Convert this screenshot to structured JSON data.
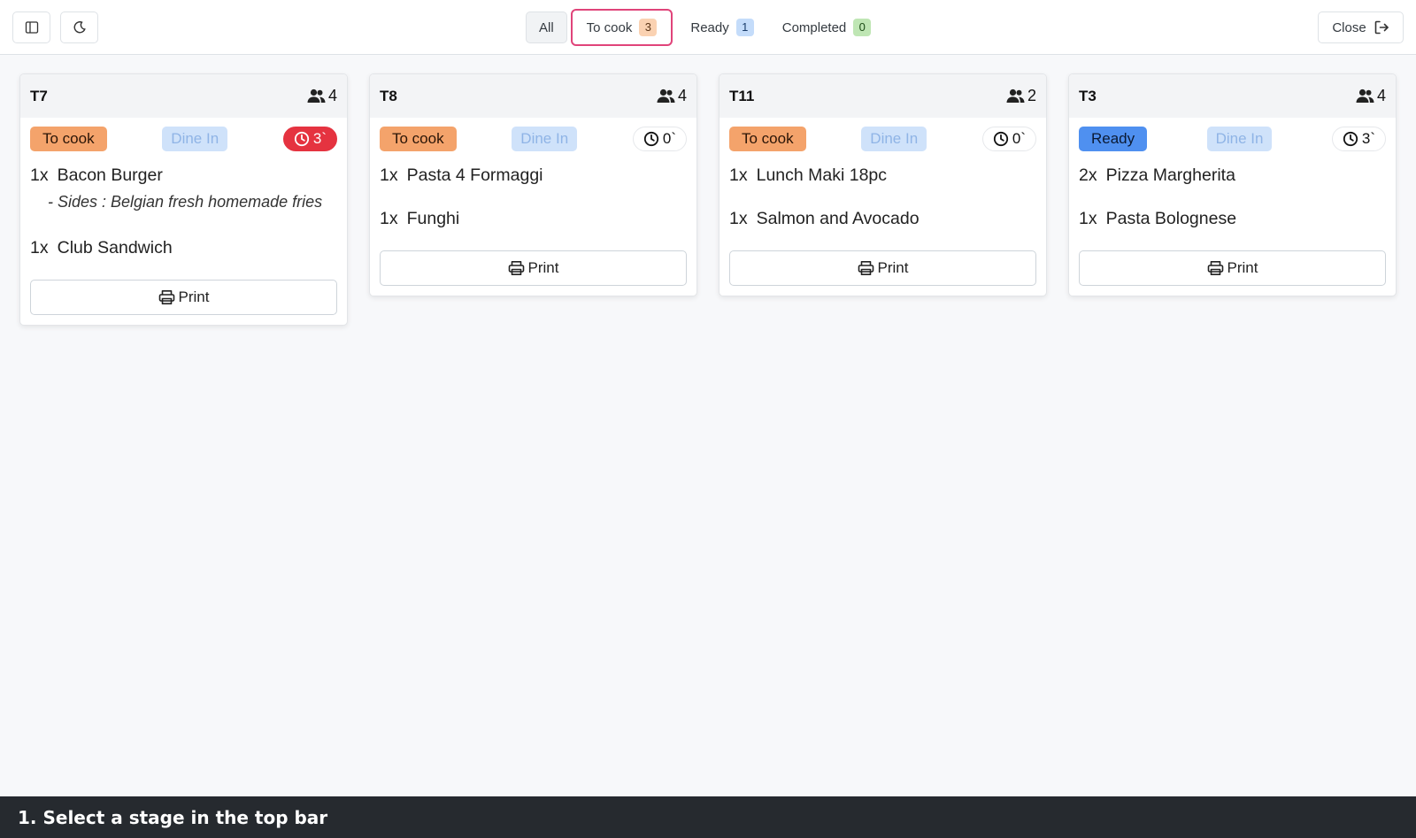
{
  "toolbar": {
    "sidebar_icon": "sidebar-toggle-icon",
    "theme_icon": "moon-icon"
  },
  "stages": [
    {
      "label": "All"
    },
    {
      "label": "To cook",
      "count": "3"
    },
    {
      "label": "Ready",
      "count": "1"
    },
    {
      "label": "Completed",
      "count": "0"
    }
  ],
  "close": {
    "label": "Close",
    "icon": "sign-out-icon"
  },
  "orders": [
    {
      "table": "T7",
      "guests": "4",
      "status": "To cook",
      "type": "Dine In",
      "timer": "3`",
      "timer_late": true,
      "lines": [
        {
          "qty": "1x",
          "name": "Bacon Burger",
          "note": "- Sides : Belgian fresh homemade fries"
        },
        {
          "qty": "1x",
          "name": "Club Sandwich"
        }
      ],
      "print_label": "Print"
    },
    {
      "table": "T8",
      "guests": "4",
      "status": "To cook",
      "type": "Dine In",
      "timer": "0`",
      "timer_late": false,
      "lines": [
        {
          "qty": "1x",
          "name": "Pasta 4 Formaggi"
        },
        {
          "qty": "1x",
          "name": "Funghi"
        }
      ],
      "print_label": "Print"
    },
    {
      "table": "T11",
      "guests": "2",
      "status": "To cook",
      "type": "Dine In",
      "timer": "0`",
      "timer_late": false,
      "lines": [
        {
          "qty": "1x",
          "name": "Lunch Maki 18pc"
        },
        {
          "qty": "1x",
          "name": "Salmon and Avocado"
        }
      ],
      "print_label": "Print"
    },
    {
      "table": "T3",
      "guests": "4",
      "status": "Ready",
      "type": "Dine In",
      "timer": "3`",
      "timer_late": false,
      "lines": [
        {
          "qty": "2x",
          "name": "Pizza Margherita"
        },
        {
          "qty": "1x",
          "name": "Pasta Bolognese"
        }
      ],
      "print_label": "Print"
    }
  ],
  "instruction": "1. Select a stage in the top bar",
  "colors": {
    "active_stage_border": "#e0447a",
    "to_cook": "#f4a36b",
    "ready": "#4f90f0",
    "dine_in": "#cfe2fa",
    "late_timer": "#e53340",
    "footer_bg": "#262a2f"
  }
}
